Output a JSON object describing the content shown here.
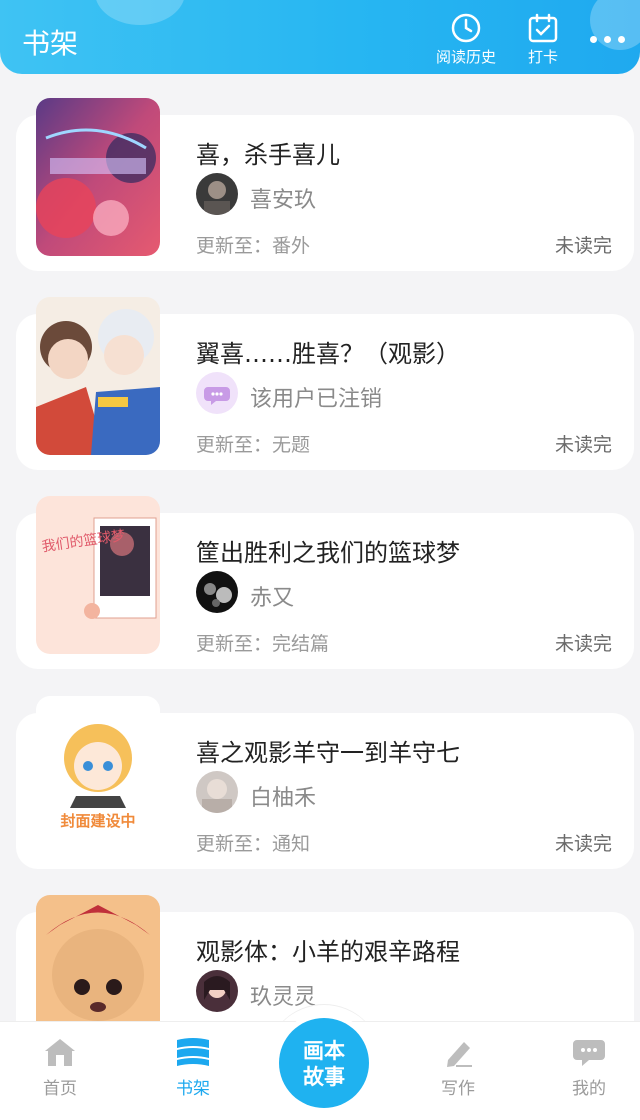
{
  "header": {
    "title": "书架",
    "history_label": "阅读历史",
    "checkin_label": "打卡",
    "history_icon": "clock-icon",
    "checkin_icon": "calendar-check-icon",
    "more_icon": "more-dots-icon"
  },
  "books": [
    {
      "title": "喜，杀手喜儿",
      "author": "喜安玖",
      "update": "更新至：番外",
      "status": "未读完"
    },
    {
      "title": "翼喜……胜喜？（观影）",
      "author": "该用户已注销",
      "update": "更新至：无题",
      "status": "未读完"
    },
    {
      "title": "筐出胜利之我们的篮球梦",
      "author": "赤又",
      "update": "更新至：完结篇",
      "status": "未读完",
      "cover_text": "我们的篮球梦"
    },
    {
      "title": "喜之观影羊守一到羊守七",
      "author": "白柚禾",
      "update": "更新至：通知",
      "status": "未读完",
      "cover_text": "封面建设中"
    },
    {
      "title": "观影体：小羊的艰辛路程",
      "author": "玖灵灵"
    }
  ],
  "nav": {
    "home": "首页",
    "shelf": "书架",
    "center_line1": "画本",
    "center_line2": "故事",
    "write": "写作",
    "mine": "我的"
  },
  "colors": {
    "accent": "#1fb2f0",
    "header_start": "#3fc3f3",
    "header_end": "#1fa9ef"
  }
}
